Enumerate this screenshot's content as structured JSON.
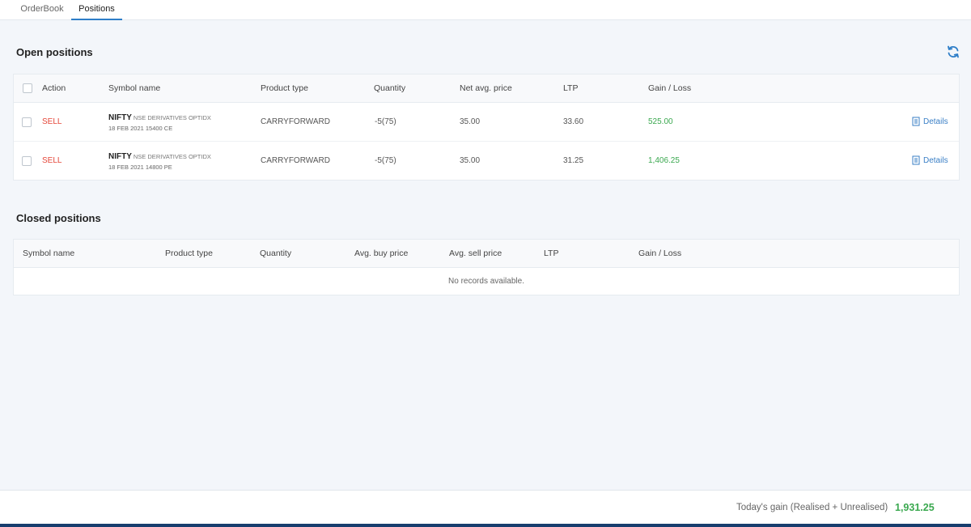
{
  "tabs": [
    {
      "label": "OrderBook",
      "active": false
    },
    {
      "label": "Positions",
      "active": true
    }
  ],
  "open_positions": {
    "title": "Open positions",
    "refresh_icon": "refresh-icon",
    "columns": {
      "action": "Action",
      "symbol": "Symbol name",
      "product": "Product type",
      "quantity": "Quantity",
      "net_avg": "Net avg. price",
      "ltp": "LTP",
      "gain": "Gain / Loss"
    },
    "rows": [
      {
        "action": "SELL",
        "symbol": "NIFTY",
        "exchange": "NSE DERIVATIVES  OPTIDX",
        "contract": "18 FEB 2021 15400 CE",
        "product": "CARRYFORWARD",
        "quantity": "-5(75)",
        "net_avg": "35.00",
        "ltp": "33.60",
        "gain": "525.00",
        "details": "Details"
      },
      {
        "action": "SELL",
        "symbol": "NIFTY",
        "exchange": "NSE DERIVATIVES  OPTIDX",
        "contract": "18 FEB 2021 14800 PE",
        "product": "CARRYFORWARD",
        "quantity": "-5(75)",
        "net_avg": "35.00",
        "ltp": "31.25",
        "gain": "1,406.25",
        "details": "Details"
      }
    ]
  },
  "closed_positions": {
    "title": "Closed positions",
    "columns": {
      "symbol": "Symbol name",
      "product": "Product type",
      "quantity": "Quantity",
      "avg_buy": "Avg. buy price",
      "avg_sell": "Avg. sell price",
      "ltp": "LTP",
      "gain": "Gain / Loss"
    },
    "empty_message": "No records available."
  },
  "footer": {
    "label": "Today's gain (Realised + Unrealised)",
    "value": "1,931.25"
  },
  "colors": {
    "sell": "#e5473a",
    "gain": "#3aa84f",
    "accent": "#2e7ec8",
    "bottom_bar": "#173d6e"
  }
}
